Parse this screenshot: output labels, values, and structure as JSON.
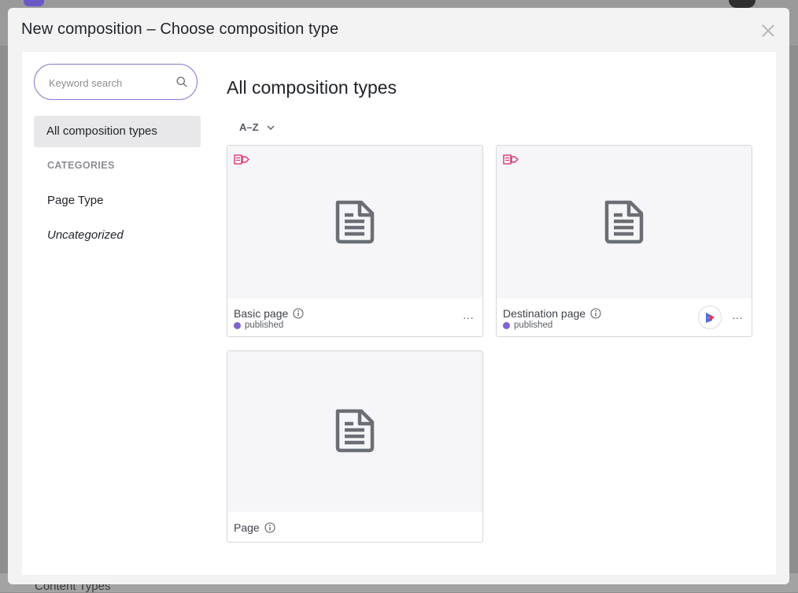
{
  "background": {
    "bottom_text": "Content Types"
  },
  "modal": {
    "title": "New composition – Choose composition type",
    "close_icon": "close-icon"
  },
  "sidebar": {
    "search_placeholder": "Keyword search",
    "active_item": "All composition types",
    "categories_heading": "CATEGORIES",
    "items": [
      {
        "label": "Page Type",
        "italic": false
      },
      {
        "label": "Uncategorized",
        "italic": true
      }
    ]
  },
  "main": {
    "title": "All composition types",
    "sort_label": "A–Z",
    "cards": [
      {
        "name": "Basic page",
        "status": "published",
        "has_badge": true,
        "has_destination_button": false
      },
      {
        "name": "Destination page",
        "status": "published",
        "has_badge": true,
        "has_destination_button": true
      },
      {
        "name": "Page",
        "status": "",
        "has_badge": false,
        "has_destination_button": false
      }
    ],
    "more_label": "···"
  },
  "colors": {
    "accent": "#8a78cf",
    "status_published": "#7f63d1",
    "badge": "#e2336f",
    "icon_gray": "#6b6e74"
  }
}
